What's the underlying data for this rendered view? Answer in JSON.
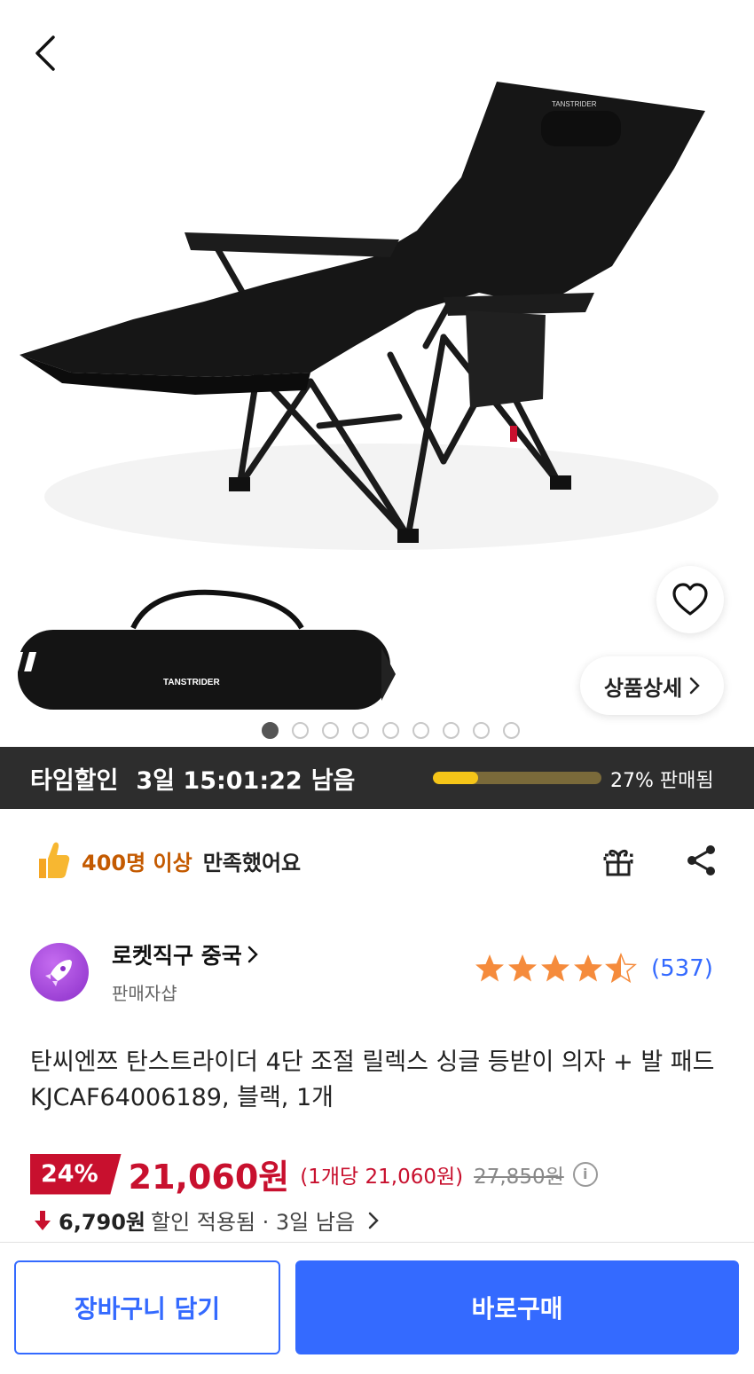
{
  "hero": {
    "brand_text": "TANSTRIDER",
    "detail_button_label": "상품상세",
    "dots_count": 9,
    "active_dot": 0
  },
  "timesale": {
    "label": "타임할인",
    "time": "3일 15:01:22",
    "remaining": "남음",
    "progress_percent": 27,
    "sold_text": "27% 판매됨"
  },
  "satisfaction": {
    "count": "400명 이상",
    "text": "만족했어요"
  },
  "seller": {
    "name": "로켓직구 중국",
    "sub": "판매자샵",
    "rating_stars": 4.5,
    "review_count": "(537)"
  },
  "product": {
    "title": "탄씨엔쯔 탄스트라이더 4단 조절 릴렉스 싱글 등받이 의자 + 발 패드 KJCAF64006189, 블랙, 1개"
  },
  "price": {
    "discount": "24%",
    "sale_price": "21,060원",
    "unit_price": "(1개당 21,060원)",
    "original_price": "27,850원",
    "info_icon": "i"
  },
  "coupon": {
    "amount": "6,790원",
    "text": "할인 적용됨 · 3일 남음"
  },
  "actions": {
    "cart_label": "장바구니 담기",
    "buy_label": "바로구매"
  },
  "colors": {
    "accent_blue": "#346aff",
    "sale_red": "#c8102e",
    "timebar_bg": "#2d2d2d",
    "progress_yellow": "#f5c518"
  }
}
